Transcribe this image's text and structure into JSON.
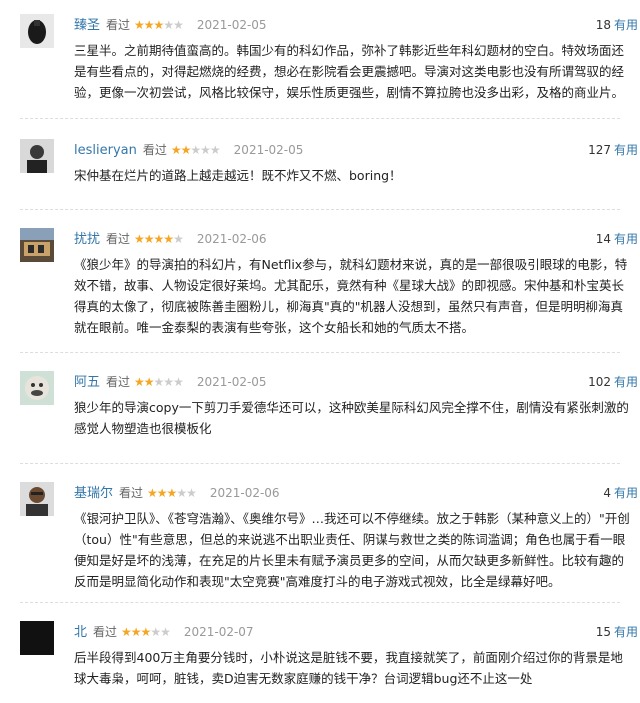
{
  "reviews": [
    {
      "user": "臻圣",
      "status": "看过",
      "rating": 3,
      "date": "2021-02-05",
      "votes": "18",
      "vote_label": "有用",
      "text": "三星半。之前期待值蛮高的。韩国少有的科幻作品，弥补了韩影近些年科幻题材的空白。特效场面还是有些看点的，对得起燃烧的经费，想必在影院看会更震撼吧。导演对这类电影也没有所谓驾驭的经验，更像一次初尝试，风格比较保守，娱乐性质更强些，剧情不算拉胯也没多出彩，及格的商业片。"
    },
    {
      "user": "leslieryan",
      "status": "看过",
      "rating": 2,
      "date": "2021-02-05",
      "votes": "127",
      "vote_label": "有用",
      "text": "宋仲基在烂片的道路上越走越远！既不炸又不燃、boring！"
    },
    {
      "user": "扰扰",
      "status": "看过",
      "rating": 4,
      "date": "2021-02-06",
      "votes": "14",
      "vote_label": "有用",
      "text": "《狼少年》的导演拍的科幻片，有Netflix参与，就科幻题材来说，真的是一部很吸引眼球的电影，特效不错，故事、人物设定很好莱坞。尤其配乐，竟然有种《星球大战》的即视感。宋仲基和朴宝英长得真的太像了，彻底被陈善圭圈粉儿，柳海真\"真的\"机器人没想到，虽然只有声音，但是明明柳海真就在眼前。唯一金泰梨的表演有些夸张，这个女船长和她的气质太不搭。"
    },
    {
      "user": "阿五",
      "status": "看过",
      "rating": 2,
      "date": "2021-02-05",
      "votes": "102",
      "vote_label": "有用",
      "text": "狼少年的导演copy一下剪刀手爱德华还可以，这种欧美星际科幻风完全撑不住，剧情没有紧张刺激的感觉人物塑造也很模板化"
    },
    {
      "user": "基瑞尔",
      "status": "看过",
      "rating": 3,
      "date": "2021-02-06",
      "votes": "4",
      "vote_label": "有用",
      "text": "《银河护卫队》、《苍穹浩瀚》、《奥维尔号》…我还可以不停继续。放之于韩影（某种意义上的）\"开创（tou）性\"有些意思，但总的来说逃不出职业责任、阴谋与救世之类的陈词滥调；角色也属于看一眼便知是好是坏的浅薄，在充足的片长里未有赋予演员更多的空间，从而欠缺更多新鲜性。比较有趣的反而是明显简化动作和表现\"太空竞赛\"高难度打斗的电子游戏式视效，比全是绿幕好吧。"
    },
    {
      "user": "北",
      "status": "看过",
      "rating": 3,
      "date": "2021-02-07",
      "votes": "15",
      "vote_label": "有用",
      "text": "后半段得到400万主角要分钱时，小朴说这是脏钱不要，我直接就笑了，前面刚介绍过你的背景是地球大毒枭，呵呵，脏钱，卖D迫害无数家庭赚的钱干净？台词逻辑bug还不止这一处"
    }
  ]
}
